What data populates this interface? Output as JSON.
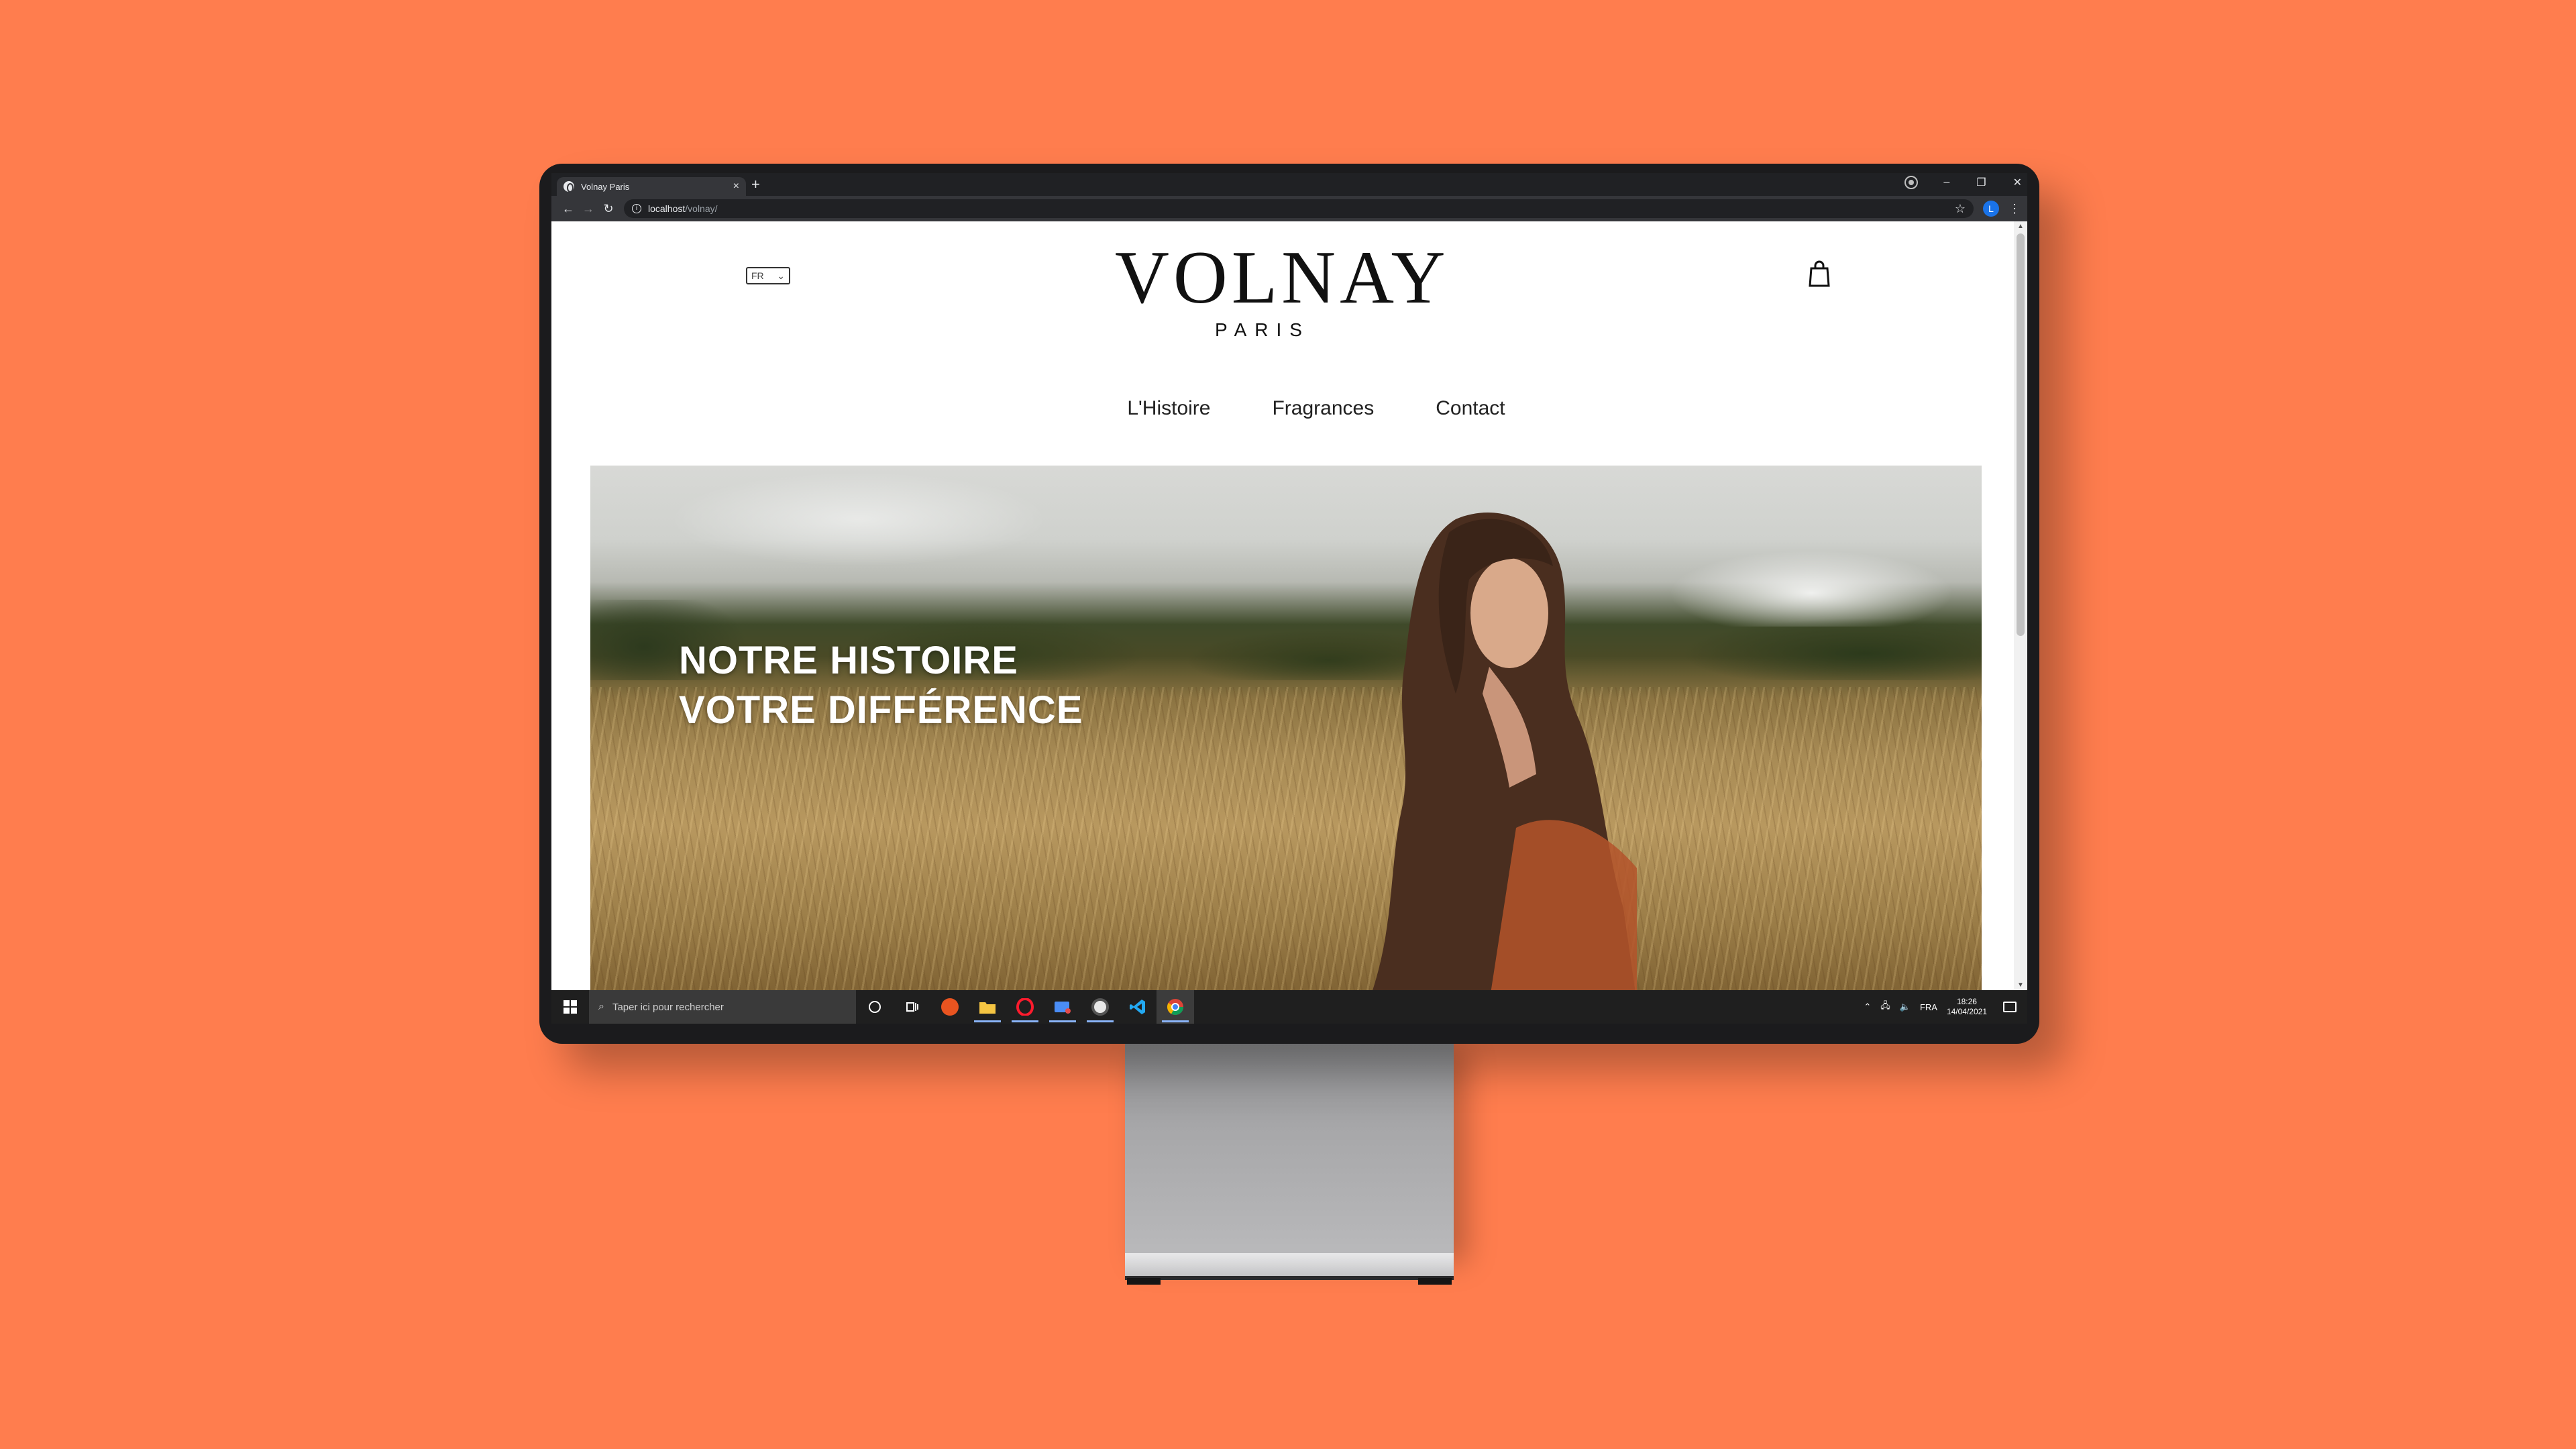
{
  "browser": {
    "tab_title": "Volnay Paris",
    "tab_close": "×",
    "new_tab": "+",
    "url_host": "localhost",
    "url_path": "/volnay/",
    "profile_initial": "L",
    "window_minimize": "–",
    "window_restore": "❐",
    "window_close": "✕"
  },
  "site": {
    "language": "FR",
    "logo": "VOLNAY",
    "logo_sub": "PARIS",
    "nav": [
      "L'Histoire",
      "Fragrances",
      "Contact"
    ],
    "hero_line1": "NOTRE HISTOIRE",
    "hero_line2": "VOTRE DIFFÉRENCE"
  },
  "taskbar": {
    "search_placeholder": "Taper ici pour rechercher",
    "language": "FRA",
    "time": "18:26",
    "date": "14/04/2021"
  },
  "colors": {
    "background": "#ff7d4e",
    "bezel": "#1b1b1d",
    "chrome_dark": "#202124",
    "taskbar": "#1f1f1f"
  }
}
